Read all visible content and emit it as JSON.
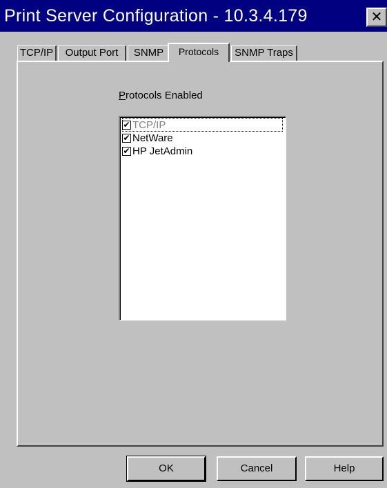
{
  "window": {
    "title": "Print Server Configuration - 10.3.4.179",
    "close_glyph": "✕"
  },
  "tabs": [
    {
      "label": "TCP/IP",
      "active": false
    },
    {
      "label": "Output Port",
      "active": false
    },
    {
      "label": "SNMP",
      "active": false
    },
    {
      "label": "Protocols",
      "active": true
    },
    {
      "label": "SNMP Traps",
      "active": false
    }
  ],
  "protocols": {
    "group_label_mnemonic": "P",
    "group_label_rest": "rotocols Enabled",
    "items": [
      {
        "label": "TCP/IP",
        "checked": true,
        "disabled": true
      },
      {
        "label": "NetWare",
        "checked": true,
        "disabled": false
      },
      {
        "label": "HP JetAdmin",
        "checked": true,
        "disabled": false
      }
    ],
    "check_glyph": "✔"
  },
  "buttons": {
    "ok": "OK",
    "cancel": "Cancel",
    "help": "Help"
  }
}
